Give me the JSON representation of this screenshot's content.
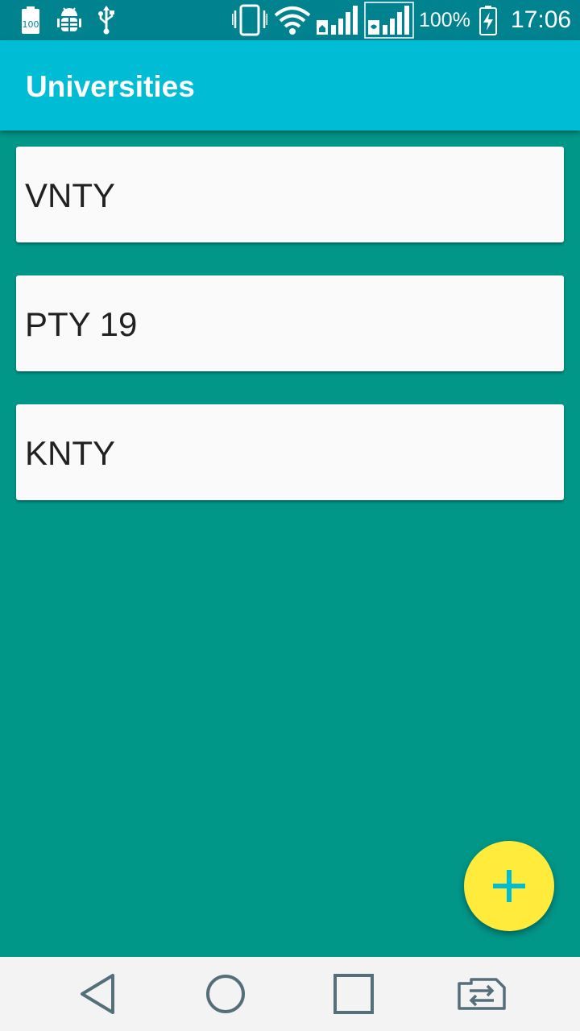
{
  "status_bar": {
    "icons": [
      "battery-saver-icon",
      "android-debug-icon",
      "usb-icon",
      "vibrate-icon",
      "wifi-icon",
      "signal-sim1-icon",
      "signal-sim2-icon",
      "battery-charging-icon"
    ],
    "battery_saver_text": "100",
    "battery_percent": "100%",
    "time": "17:06",
    "color": "#00838f"
  },
  "app_bar": {
    "title": "Universities",
    "color": "#00bcd4"
  },
  "universities": [
    {
      "name": "VNTY"
    },
    {
      "name": "PTY 19"
    },
    {
      "name": "KNTY"
    }
  ],
  "fab": {
    "icon": "plus-icon",
    "color": "#ffeb3b",
    "icon_color": "#00bcd4"
  },
  "nav_bar": {
    "buttons": [
      "back-icon",
      "home-icon",
      "recents-icon",
      "sim-switch-icon"
    ]
  },
  "colors": {
    "background": "#009688",
    "card": "#fafafa"
  }
}
